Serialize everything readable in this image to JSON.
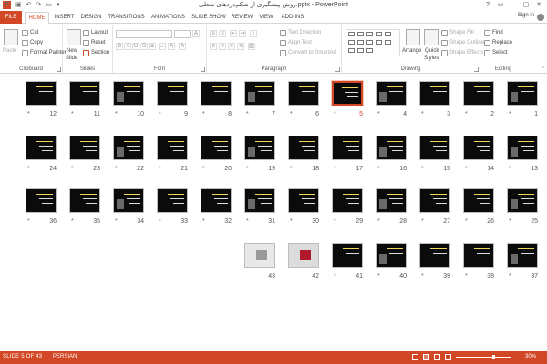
{
  "window": {
    "title": "روش پیشگیری از شکم‌درد‌های شغلی.pptx - PowerPoint",
    "controls": [
      "?",
      "▭",
      "—",
      "▢",
      "✕"
    ]
  },
  "qat": {
    "undo": "↶",
    "redo": "↷",
    "customize": "▾"
  },
  "tabs": [
    "FILE",
    "HOME",
    "INSERT",
    "DESIGN",
    "TRANSITIONS",
    "ANIMATIONS",
    "SLIDE SHOW",
    "REVIEW",
    "VIEW",
    "ADD-INS"
  ],
  "active_tab": "HOME",
  "signin": "Sign in",
  "ribbon": {
    "clipboard": {
      "label": "Clipboard",
      "paste": "Paste",
      "cut": "Cut",
      "copy": "Copy",
      "format_painter": "Format Painter"
    },
    "slides": {
      "label": "Slides",
      "new_slide": "New",
      "new_slide2": "Slide",
      "layout": "Layout",
      "reset": "Reset",
      "section": "Section"
    },
    "font": {
      "label": "Font"
    },
    "paragraph": {
      "label": "Paragraph",
      "text_direction": "Text Direction",
      "align_text": "Align Text",
      "convert_smartart": "Convert to SmartArt"
    },
    "drawing": {
      "label": "Drawing",
      "arrange": "Arrange",
      "quick_styles": "Quick",
      "quick_styles2": "Styles",
      "shape_fill": "Shape Fill",
      "shape_outline": "Shape Outline",
      "shape_effects": "Shape Effects"
    },
    "editing": {
      "label": "Editing",
      "find": "Find",
      "replace": "Replace",
      "select": "Select"
    }
  },
  "slides": [
    {
      "n": "1"
    },
    {
      "n": "2"
    },
    {
      "n": "3"
    },
    {
      "n": "4"
    },
    {
      "n": "5"
    },
    {
      "n": "6"
    },
    {
      "n": "7"
    },
    {
      "n": "8"
    },
    {
      "n": "9"
    },
    {
      "n": "10"
    },
    {
      "n": "11"
    },
    {
      "n": "12"
    },
    {
      "n": "13"
    },
    {
      "n": "14"
    },
    {
      "n": "15"
    },
    {
      "n": "16"
    },
    {
      "n": "17"
    },
    {
      "n": "18"
    },
    {
      "n": "19"
    },
    {
      "n": "20"
    },
    {
      "n": "21"
    },
    {
      "n": "22"
    },
    {
      "n": "23"
    },
    {
      "n": "24"
    },
    {
      "n": "25"
    },
    {
      "n": "26"
    },
    {
      "n": "27"
    },
    {
      "n": "28"
    },
    {
      "n": "29"
    },
    {
      "n": "30"
    },
    {
      "n": "31"
    },
    {
      "n": "32"
    },
    {
      "n": "33"
    },
    {
      "n": "34"
    },
    {
      "n": "35"
    },
    {
      "n": "36"
    },
    {
      "n": "37"
    },
    {
      "n": "38"
    },
    {
      "n": "39"
    },
    {
      "n": "40"
    },
    {
      "n": "41"
    },
    {
      "n": "42"
    },
    {
      "n": "43"
    }
  ],
  "selected_slide": "5",
  "star": "*",
  "status": {
    "slide_info": "SLIDE 5 OF 43",
    "language": "PERSIAN",
    "zoom": "30%"
  },
  "colors": {
    "accent": "#d24726",
    "slide_bg": "#0b0b0b"
  }
}
